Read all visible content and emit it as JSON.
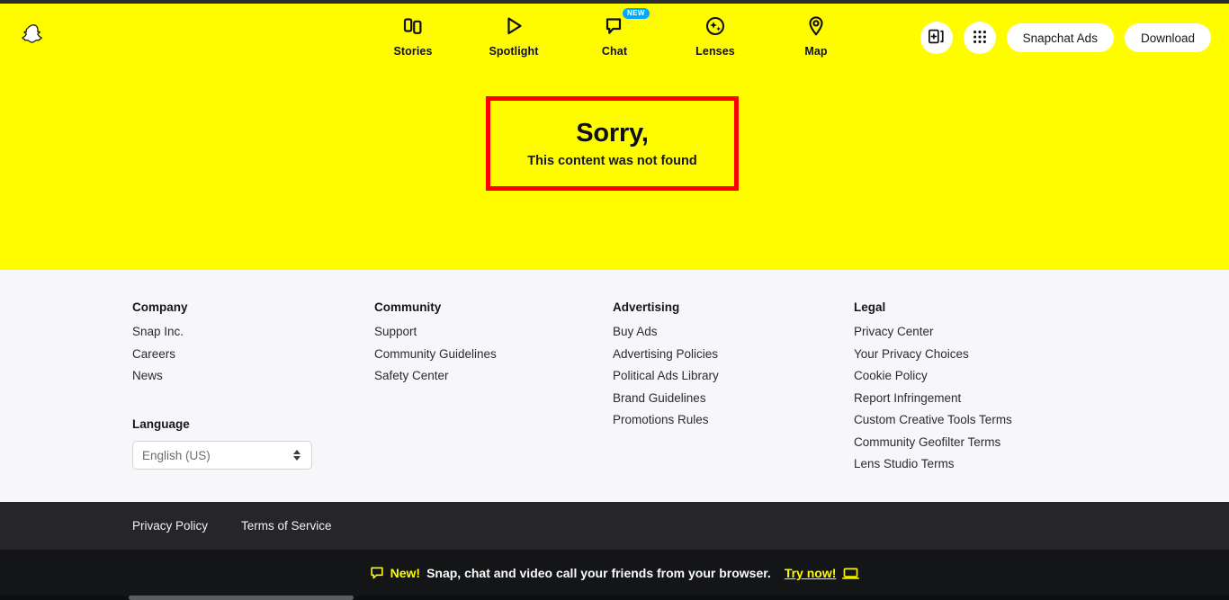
{
  "brand": {
    "name": "Snapchat",
    "logo_icon": "snapchat-ghost-icon",
    "yellow": "#FFFC00",
    "badge_blue": "#00A8FF",
    "highlight_red": "#FF0000"
  },
  "nav": {
    "items": [
      {
        "label": "Stories",
        "icon": "stories-icon"
      },
      {
        "label": "Spotlight",
        "icon": "spotlight-play-icon"
      },
      {
        "label": "Chat",
        "icon": "chat-bubble-icon",
        "badge": "NEW"
      },
      {
        "label": "Lenses",
        "icon": "lenses-sparkle-icon"
      },
      {
        "label": "Map",
        "icon": "map-pin-icon"
      }
    ],
    "right": {
      "add_to_story_icon": "add-card-icon",
      "apps_grid_icon": "grid-dots-icon",
      "ads_label": "Snapchat Ads",
      "download_label": "Download"
    }
  },
  "hero": {
    "title": "Sorry,",
    "subtitle": "This content was not found"
  },
  "footer": {
    "columns": [
      {
        "heading": "Company",
        "links": [
          "Snap Inc.",
          "Careers",
          "News"
        ]
      },
      {
        "heading": "Community",
        "links": [
          "Support",
          "Community Guidelines",
          "Safety Center"
        ]
      },
      {
        "heading": "Advertising",
        "links": [
          "Buy Ads",
          "Advertising Policies",
          "Political Ads Library",
          "Brand Guidelines",
          "Promotions Rules"
        ]
      },
      {
        "heading": "Legal",
        "links": [
          "Privacy Center",
          "Your Privacy Choices",
          "Cookie Policy",
          "Report Infringement",
          "Custom Creative Tools Terms",
          "Community Geofilter Terms",
          "Lens Studio Terms"
        ]
      }
    ],
    "language": {
      "label": "Language",
      "selected": "English (US)",
      "options": [
        "English (US)"
      ]
    }
  },
  "legal_bar": {
    "links": [
      "Privacy Policy",
      "Terms of Service"
    ]
  },
  "promo": {
    "bubble_icon": "chat-bubble-outline-icon",
    "new_label": "New!",
    "message": "Snap, chat and video call your friends from your browser.",
    "cta_label": "Try now!",
    "laptop_icon": "laptop-icon"
  }
}
